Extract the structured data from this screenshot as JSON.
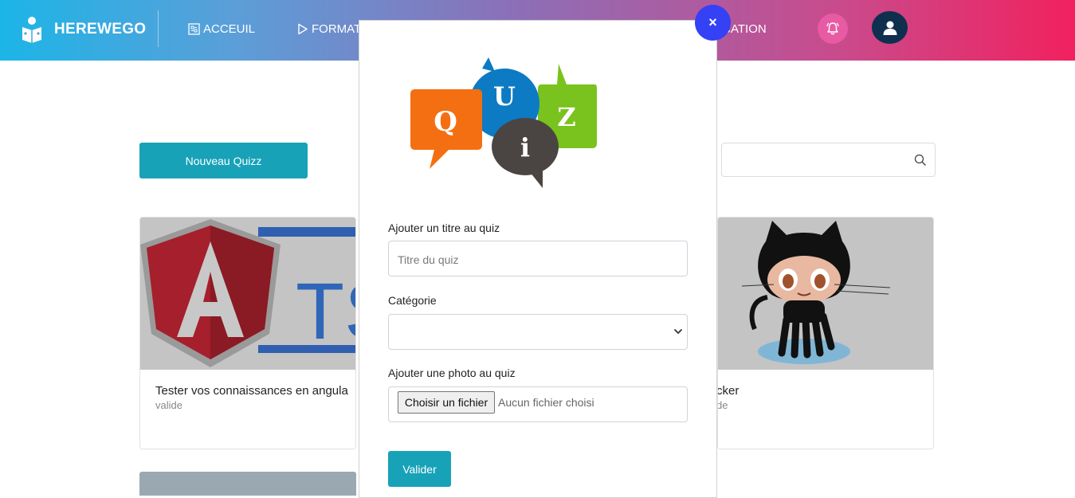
{
  "brand": {
    "name": "HEREWEGO"
  },
  "nav": {
    "accueil": "ACCEUIL",
    "formations": "FORMAT",
    "communication": "ICATION"
  },
  "page": {
    "new_quiz_button": "Nouveau Quizz",
    "search_placeholder": "",
    "cards": [
      {
        "title": "Tester vos connaissances en angula",
        "status": "valide",
        "image": "angular-typescript-logo"
      },
      {
        "title": "cker",
        "status": "de",
        "image": "github-octocat"
      }
    ]
  },
  "modal": {
    "logo": "quiz-speech-bubbles",
    "logo_letters": [
      "Q",
      "U",
      "Z",
      "i"
    ],
    "title_label": "Ajouter un titre au quiz",
    "title_placeholder": "Titre du quiz",
    "category_label": "Catégorie",
    "category_value": "",
    "photo_label": "Ajouter une photo  au quiz",
    "file_button": "Choisir un fichier",
    "file_none": "Aucun fichier choisi",
    "submit": "Valider",
    "close_icon": "×"
  },
  "colors": {
    "teal_button": "#17a2b8",
    "close_button": "#3441f5",
    "nav_gradient_start": "#1cb5e7",
    "nav_gradient_end": "#f1215f",
    "user_avatar": "#0f2f4f",
    "bell_circle": "#e85aa4"
  }
}
